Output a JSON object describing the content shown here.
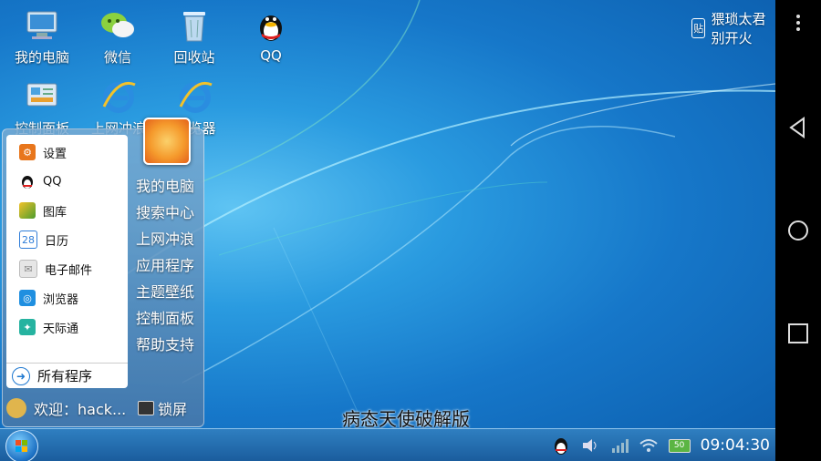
{
  "desktop_icons": [
    {
      "label": "我的电脑",
      "icon": "computer-icon"
    },
    {
      "label": "微信",
      "icon": "wechat-icon"
    },
    {
      "label": "回收站",
      "icon": "recycle-bin-icon"
    },
    {
      "label": "QQ",
      "icon": "qq-penguin-icon"
    },
    {
      "label": "控制面板",
      "icon": "control-panel-icon"
    },
    {
      "label": "上网冲浪",
      "icon": "ie-icon"
    },
    {
      "label": "浏览器",
      "icon": "ie-icon"
    }
  ],
  "watermark": {
    "badge": "贴",
    "text": "猥琐太君别开火"
  },
  "start_menu": {
    "items": [
      {
        "label": "设置",
        "icon": "settings-icon",
        "color": "#e8761c"
      },
      {
        "label": "QQ",
        "icon": "qq-penguin-icon",
        "color": "#ffffff"
      },
      {
        "label": "图库",
        "icon": "gallery-icon",
        "color": "#4c9c2e"
      },
      {
        "label": "日历",
        "icon": "calendar-icon",
        "color": "#2f7dd8",
        "glyph": "28"
      },
      {
        "label": "电子邮件",
        "icon": "mail-icon",
        "color": "#cfcfcf"
      },
      {
        "label": "浏览器",
        "icon": "browser-icon",
        "color": "#1f8fe0"
      },
      {
        "label": "天际通",
        "icon": "skyroam-icon",
        "color": "#26b3a0"
      }
    ],
    "all_programs": "所有程序",
    "right_items": [
      "我的电脑",
      "搜索中心",
      "上网冲浪",
      "应用程序",
      "主题壁纸",
      "控制面板",
      "帮助支持"
    ],
    "welcome": "欢迎：hack...",
    "lock": "锁屏"
  },
  "subtitle": "病态天使破解版",
  "taskbar": {
    "clock": "09:04:30",
    "battery": "50"
  }
}
